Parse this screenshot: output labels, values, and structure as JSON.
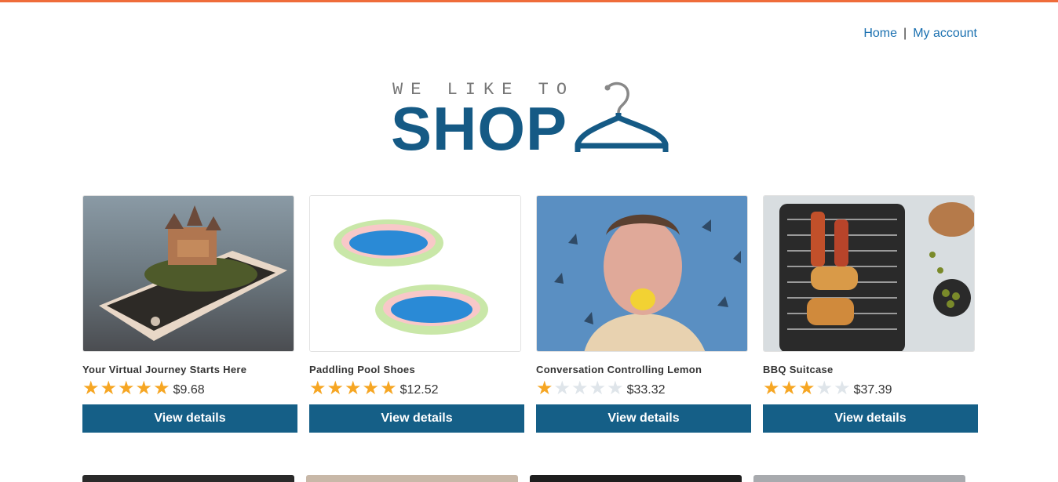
{
  "header": {
    "nav": {
      "home": "Home",
      "separator": "|",
      "my_account": "My account"
    },
    "accent_color": "#ef6c3a"
  },
  "logo": {
    "tagline": "WE LIKE TO",
    "brand": "SHOP"
  },
  "products": [
    {
      "title": "Your Virtual Journey Starts Here",
      "rating": 5,
      "price": "$9.68",
      "button": "View details",
      "image": "phone-castle-image"
    },
    {
      "title": "Paddling Pool Shoes",
      "rating": 5,
      "price": "$12.52",
      "button": "View details",
      "image": "paddling-pools-image"
    },
    {
      "title": "Conversation Controlling Lemon",
      "rating": 1,
      "price": "$33.32",
      "button": "View details",
      "image": "lemon-man-image"
    },
    {
      "title": "BBQ Suitcase",
      "rating": 3,
      "price": "$37.39",
      "button": "View details",
      "image": "bbq-grill-image"
    }
  ],
  "colors": {
    "button": "#155f87",
    "star_on": "#f6a623",
    "star_off": "#dfe5ea",
    "link": "#1a70b0"
  }
}
